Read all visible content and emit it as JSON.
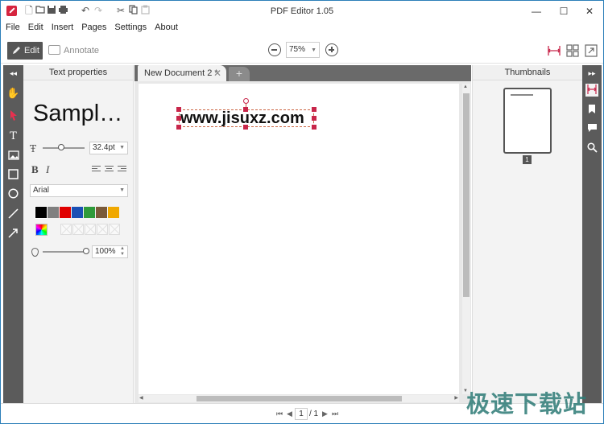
{
  "titlebar": {
    "title": "PDF Editor 1.05",
    "controls": {
      "minimize": "—",
      "maximize": "☐",
      "close": "✕"
    }
  },
  "menu": [
    "File",
    "Edit",
    "Insert",
    "Pages",
    "Settings",
    "About"
  ],
  "toolbar": {
    "edit_label": "Edit",
    "annotate_label": "Annotate",
    "zoom_value": "75%"
  },
  "left_panel": {
    "title": "Text properties",
    "sample_text": "Sampl…",
    "font_size": "32.4pt",
    "font_family": "Arial",
    "bold_label": "B",
    "italic_label": "I",
    "opacity": "100%",
    "colors": [
      "#000000",
      "#808080",
      "#e00000",
      "#1a4fb4",
      "#2e9a3a",
      "#7a5a3a",
      "#f0a800"
    ]
  },
  "tabs": {
    "active": "New Document 2 *",
    "close_glyph": "✕",
    "new_tab_glyph": "+"
  },
  "document": {
    "text": "www.jisuxz.com"
  },
  "right_panel": {
    "title": "Thumbnails",
    "page_number": "1"
  },
  "statusbar": {
    "current_page": "1",
    "total_pages": "/ 1"
  },
  "watermark": "极速下载站"
}
